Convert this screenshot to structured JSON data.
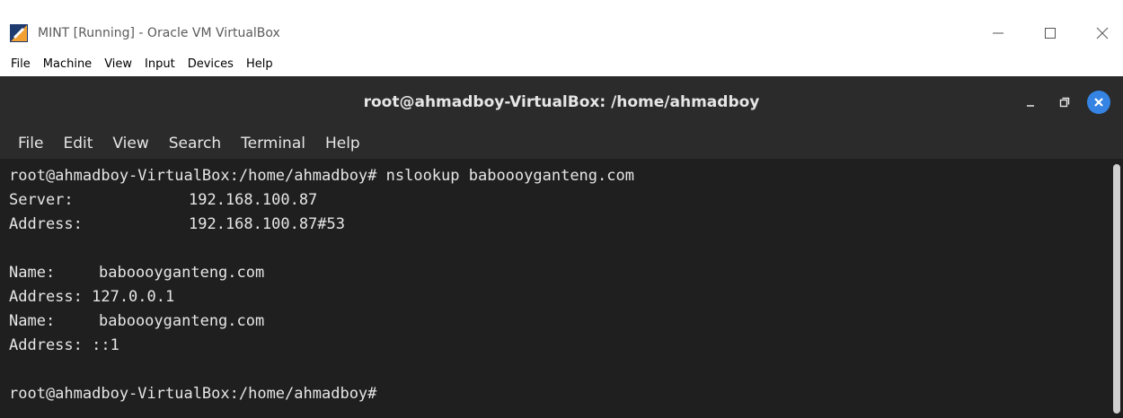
{
  "vbox": {
    "title": "MINT [Running] - Oracle VM VirtualBox",
    "menu": [
      "File",
      "Machine",
      "View",
      "Input",
      "Devices",
      "Help"
    ]
  },
  "terminal": {
    "title": "root@ahmadboy-VirtualBox: /home/ahmadboy",
    "menu": [
      "File",
      "Edit",
      "View",
      "Search",
      "Terminal",
      "Help"
    ],
    "lines": {
      "cmd": "root@ahmadboy-VirtualBox:/home/ahmadboy# nslookup baboooyganteng.com",
      "server_label": "Server:",
      "server_value": "192.168.100.87",
      "address_label": "Address:",
      "address_value": "192.168.100.87#53",
      "name1_label": "Name:",
      "name1_value": "baboooyganteng.com",
      "addr1": "Address: 127.0.0.1",
      "name2_label": "Name:",
      "name2_value": "baboooyganteng.com",
      "addr2": "Address: ::1",
      "prompt": "root@ahmadboy-VirtualBox:/home/ahmadboy#"
    }
  },
  "colors": {
    "terminal_bg": "#1f1f1f",
    "terminal_header": "#2b2b2b",
    "accent_close": "#3584e4"
  }
}
